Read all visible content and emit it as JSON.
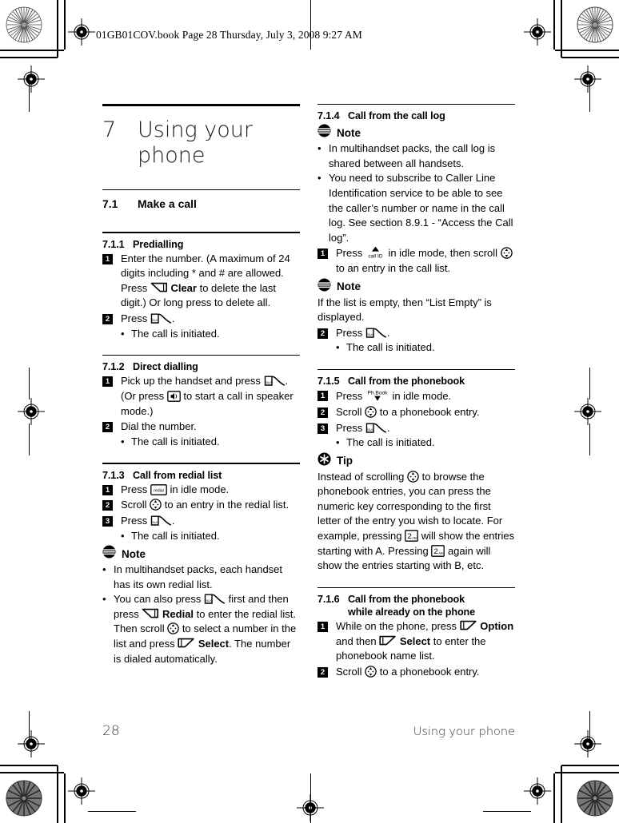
{
  "printer_header": "01GB01COV.book  Page 28  Thursday, July 3, 2008  9:27 AM",
  "chapter": {
    "number": "7",
    "title": "Using your phone"
  },
  "section": {
    "number": "7.1",
    "title": "Make a call"
  },
  "footer": {
    "page_number": "28",
    "running_title": "Using your phone"
  },
  "left_column": {
    "s711": {
      "number": "7.1.1",
      "title": "Predialling",
      "steps": [
        {
          "num": "1",
          "parts": [
            {
              "t": "text",
              "v": "Enter the number. (A maximum of 24 digits including * and # are allowed. Press "
            },
            {
              "t": "icon",
              "v": "softkey-left-icon"
            },
            {
              "t": "bold",
              "v": " Clear"
            },
            {
              "t": "text",
              "v": " to delete the last digit.) Or long press to delete all."
            }
          ]
        },
        {
          "num": "2",
          "parts": [
            {
              "t": "text",
              "v": "Press "
            },
            {
              "t": "icon",
              "v": "talk-key-icon"
            },
            {
              "t": "text",
              "v": "."
            }
          ],
          "bullets": [
            "The call is initiated."
          ]
        }
      ]
    },
    "s712": {
      "number": "7.1.2",
      "title": "Direct dialling",
      "steps": [
        {
          "num": "1",
          "parts": [
            {
              "t": "text",
              "v": "Pick up the handset and press "
            },
            {
              "t": "icon",
              "v": "talk-key-icon"
            },
            {
              "t": "text",
              "v": ". (Or press "
            },
            {
              "t": "icon",
              "v": "speaker-key-icon"
            },
            {
              "t": "text",
              "v": " to start a call in speaker mode.)"
            }
          ]
        },
        {
          "num": "2",
          "parts": [
            {
              "t": "text",
              "v": "Dial the number."
            }
          ],
          "bullets": [
            "The call is initiated."
          ]
        }
      ]
    },
    "s713": {
      "number": "7.1.3",
      "title": "Call from redial list",
      "steps": [
        {
          "num": "1",
          "parts": [
            {
              "t": "text",
              "v": "Press "
            },
            {
              "t": "icon",
              "v": "redial-key-icon"
            },
            {
              "t": "text",
              "v": " in idle mode."
            }
          ]
        },
        {
          "num": "2",
          "parts": [
            {
              "t": "text",
              "v": "Scroll "
            },
            {
              "t": "icon",
              "v": "navigator-key-icon"
            },
            {
              "t": "text",
              "v": " to an entry in the redial list."
            }
          ]
        },
        {
          "num": "3",
          "parts": [
            {
              "t": "text",
              "v": "Press "
            },
            {
              "t": "icon",
              "v": "talk-key-icon"
            },
            {
              "t": "text",
              "v": "."
            }
          ],
          "bullets": [
            "The call is initiated."
          ]
        }
      ],
      "note": {
        "label": "Note",
        "icon": "note-icon",
        "bullets": [
          [
            {
              "t": "text",
              "v": "In multihandset packs, each handset has its own redial list."
            }
          ],
          [
            {
              "t": "text",
              "v": "You can also press "
            },
            {
              "t": "icon",
              "v": "talk-key-icon"
            },
            {
              "t": "text",
              "v": " first and then press "
            },
            {
              "t": "icon",
              "v": "softkey-left-icon"
            },
            {
              "t": "bold",
              "v": " Redial"
            },
            {
              "t": "text",
              "v": " to enter the redial list. Then scroll "
            },
            {
              "t": "icon",
              "v": "navigator-key-icon"
            },
            {
              "t": "text",
              "v": " to select a number in the list and press "
            },
            {
              "t": "icon",
              "v": "softkey-right-icon"
            },
            {
              "t": "bold",
              "v": " Select"
            },
            {
              "t": "text",
              "v": ". The number is dialed automatically."
            }
          ]
        ]
      }
    }
  },
  "right_column": {
    "s714": {
      "number": "7.1.4",
      "title": "Call from the call log",
      "note1": {
        "label": "Note",
        "icon": "note-icon",
        "bullets": [
          [
            {
              "t": "text",
              "v": "In multihandset packs, the call log is shared between all handsets."
            }
          ],
          [
            {
              "t": "text",
              "v": "You need to subscribe to Caller Line Identification service to be able to see the caller’s number or name in the call log. See section 8.9.1 - “Access the Call log”."
            }
          ]
        ]
      },
      "steps1": [
        {
          "num": "1",
          "parts": [
            {
              "t": "text",
              "v": "Press "
            },
            {
              "t": "icon",
              "v": "call-id-key-icon"
            },
            {
              "t": "text",
              "v": " in idle mode, then scroll "
            },
            {
              "t": "icon",
              "v": "navigator-key-icon"
            },
            {
              "t": "text",
              "v": " to an entry in the call list."
            }
          ]
        }
      ],
      "note2": {
        "label": "Note",
        "icon": "note-icon",
        "paragraph": "If the list is empty, then “List Empty” is displayed."
      },
      "steps2": [
        {
          "num": "2",
          "parts": [
            {
              "t": "text",
              "v": "Press "
            },
            {
              "t": "icon",
              "v": "talk-key-icon"
            },
            {
              "t": "text",
              "v": "."
            }
          ],
          "bullets": [
            "The call is initiated."
          ]
        }
      ]
    },
    "s715": {
      "number": "7.1.5",
      "title": "Call from the phonebook",
      "steps": [
        {
          "num": "1",
          "parts": [
            {
              "t": "text",
              "v": "Press "
            },
            {
              "t": "icon",
              "v": "phonebook-key-icon"
            },
            {
              "t": "text",
              "v": " in idle mode."
            }
          ]
        },
        {
          "num": "2",
          "parts": [
            {
              "t": "text",
              "v": "Scroll "
            },
            {
              "t": "icon",
              "v": "navigator-key-icon"
            },
            {
              "t": "text",
              "v": " to a phonebook entry."
            }
          ]
        },
        {
          "num": "3",
          "parts": [
            {
              "t": "text",
              "v": "Press "
            },
            {
              "t": "icon",
              "v": "talk-key-icon"
            },
            {
              "t": "text",
              "v": "."
            }
          ],
          "bullets": [
            "The call is initiated."
          ]
        }
      ],
      "tip": {
        "label": "Tip",
        "icon": "tip-icon",
        "paragraph_parts": [
          {
            "t": "text",
            "v": "Instead of scrolling "
          },
          {
            "t": "icon",
            "v": "navigator-key-icon"
          },
          {
            "t": "text",
            "v": " to browse the phonebook entries, you can press the numeric key corresponding to the first letter of the entry you wish to locate. For example, pressing "
          },
          {
            "t": "icon",
            "v": "numeric-key-2-icon"
          },
          {
            "t": "text",
            "v": " will show the entries starting with A. Pressing "
          },
          {
            "t": "icon",
            "v": "numeric-key-2-icon"
          },
          {
            "t": "text",
            "v": " again will show the entries starting with B, etc."
          }
        ]
      }
    },
    "s716": {
      "number": "7.1.6",
      "title_line1": "Call from the phonebook",
      "title_line2": "while already on the phone",
      "steps": [
        {
          "num": "1",
          "parts": [
            {
              "t": "text",
              "v": "While on the phone, press "
            },
            {
              "t": "icon",
              "v": "softkey-right-icon"
            },
            {
              "t": "bold",
              "v": " Option"
            },
            {
              "t": "text",
              "v": " and then "
            },
            {
              "t": "icon",
              "v": "softkey-right-icon"
            },
            {
              "t": "bold",
              "v": " Select"
            },
            {
              "t": "text",
              "v": " to enter the phonebook name list."
            }
          ]
        },
        {
          "num": "2",
          "parts": [
            {
              "t": "text",
              "v": "Scroll "
            },
            {
              "t": "icon",
              "v": "navigator-key-icon"
            },
            {
              "t": "text",
              "v": " to a phonebook entry."
            }
          ]
        }
      ]
    }
  }
}
